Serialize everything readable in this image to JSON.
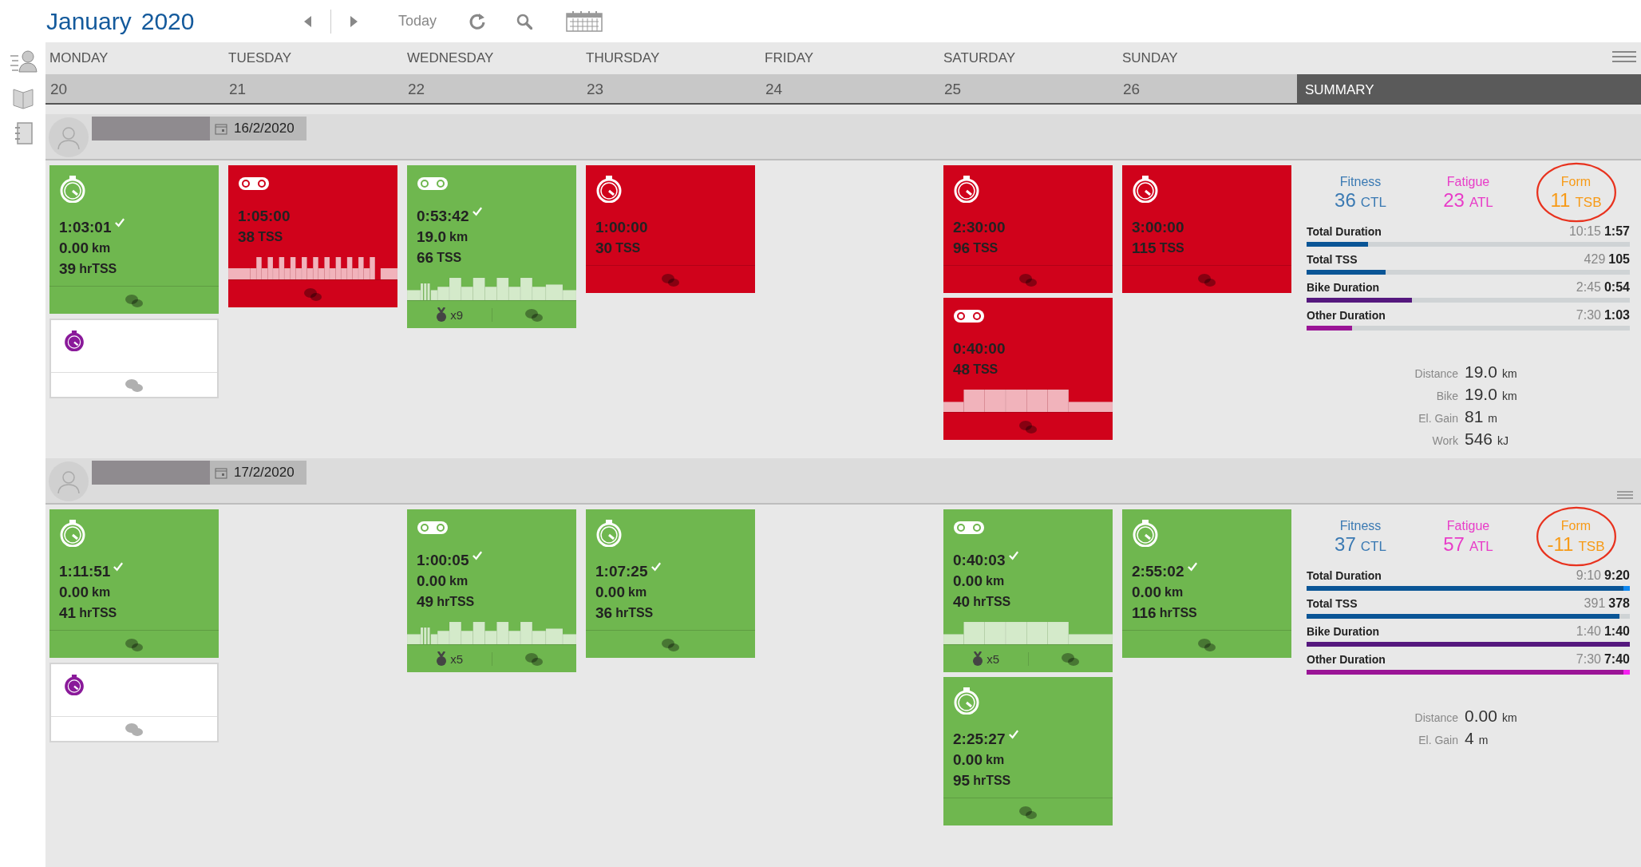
{
  "toolbar": {
    "month": "January",
    "year": "2020",
    "today": "Today"
  },
  "days": [
    {
      "name": "MONDAY",
      "date": "20"
    },
    {
      "name": "TUESDAY",
      "date": "21"
    },
    {
      "name": "WEDNESDAY",
      "date": "22"
    },
    {
      "name": "THURSDAY",
      "date": "23"
    },
    {
      "name": "FRIDAY",
      "date": "24"
    },
    {
      "name": "SATURDAY",
      "date": "25"
    },
    {
      "name": "SUNDAY",
      "date": "26"
    }
  ],
  "summary_label": "SUMMARY",
  "weeks": [
    {
      "date": "16/2/2020",
      "menu": false,
      "days": [
        {
          "kind": "training",
          "cards": [
            {
              "kind": "other",
              "planned": false,
              "color": "#6fb74f",
              "duration": "1:03:01",
              "check": true,
              "distance": {
                "value": "0.00",
                "unit": "km"
              },
              "load": {
                "value": "39",
                "unit": "hrTSS"
              }
            },
            {
              "kind": "other",
              "planned": true
            }
          ]
        },
        {
          "kind": "training",
          "cards": [
            {
              "kind": "bike",
              "planned": false,
              "color": "#d0021b",
              "duration": "1:05:00",
              "check": false,
              "load": {
                "value": "38",
                "unit": "TSS"
              },
              "profile": {
                "kind": "intervals"
              }
            }
          ]
        },
        {
          "kind": "training",
          "cards": [
            {
              "kind": "bike",
              "planned": false,
              "color": "#6fb74f",
              "duration": "0:53:42",
              "check": true,
              "distance": {
                "value": "19.0",
                "unit": "km"
              },
              "load": {
                "value": "66",
                "unit": "TSS"
              },
              "profile": {
                "kind": "mixed"
              },
              "medals": "x9"
            }
          ]
        },
        {
          "kind": "training",
          "cards": [
            {
              "kind": "other",
              "planned": false,
              "color": "#d0021b",
              "duration": "1:00:00",
              "check": false,
              "load": {
                "value": "30",
                "unit": "TSS"
              }
            }
          ]
        },
        {
          "kind": "rest"
        },
        {
          "kind": "training",
          "cards": [
            {
              "kind": "other",
              "planned": false,
              "color": "#d0021b",
              "duration": "2:30:00",
              "check": false,
              "load": {
                "value": "96",
                "unit": "TSS"
              }
            },
            {
              "kind": "bike",
              "planned": false,
              "color": "#d0021b",
              "duration": "0:40:00",
              "check": false,
              "load": {
                "value": "48",
                "unit": "TSS"
              },
              "profile": {
                "kind": "steady"
              }
            }
          ]
        },
        {
          "kind": "training",
          "cards": [
            {
              "kind": "other",
              "planned": false,
              "color": "#d0021b",
              "duration": "3:00:00",
              "check": false,
              "load": {
                "value": "115",
                "unit": "TSS"
              }
            }
          ]
        }
      ],
      "summary": {
        "fitness": {
          "label": "Fitness",
          "value": "36",
          "unit": "CTL"
        },
        "fatigue": {
          "label": "Fatigue",
          "value": "23",
          "unit": "ATL"
        },
        "form": {
          "label": "Form",
          "value": "11",
          "unit": "TSB",
          "circled": true
        },
        "bars": [
          {
            "label": "Total Duration",
            "planned": "10:15",
            "actual": "1:57",
            "level": 0.19,
            "over": false,
            "color": "#0a5596"
          },
          {
            "label": "Total TSS",
            "planned": "429",
            "actual": "105",
            "level": 0.245,
            "over": false,
            "color": "#0a5596"
          },
          {
            "label": "Bike Duration",
            "planned": "2:45",
            "actual": "0:54",
            "level": 0.325,
            "over": false,
            "color": "#55187e"
          },
          {
            "label": "Other Duration",
            "planned": "7:30",
            "actual": "1:03",
            "level": 0.14,
            "over": false,
            "color": "#9a1496"
          }
        ],
        "totals": [
          {
            "label": "Distance",
            "value": "19.0",
            "unit": "km"
          },
          {
            "label": "Bike",
            "value": "19.0",
            "unit": "km"
          },
          {
            "label": "El. Gain",
            "value": "81",
            "unit": "m"
          },
          {
            "label": "Work",
            "value": "546",
            "unit": "kJ"
          }
        ]
      }
    },
    {
      "date": "17/2/2020",
      "menu": true,
      "days": [
        {
          "kind": "training",
          "cards": [
            {
              "kind": "other",
              "planned": false,
              "color": "#6fb74f",
              "duration": "1:11:51",
              "check": true,
              "distance": {
                "value": "0.00",
                "unit": "km"
              },
              "load": {
                "value": "41",
                "unit": "hrTSS"
              }
            },
            {
              "kind": "other",
              "planned": true
            }
          ]
        },
        {
          "kind": "rest"
        },
        {
          "kind": "training",
          "cards": [
            {
              "kind": "bike",
              "planned": false,
              "color": "#6fb74f",
              "duration": "1:00:05",
              "check": true,
              "distance": {
                "value": "0.00",
                "unit": "km"
              },
              "load": {
                "value": "49",
                "unit": "hrTSS"
              },
              "profile": {
                "kind": "mixed"
              },
              "medals": "x5"
            }
          ]
        },
        {
          "kind": "training",
          "cards": [
            {
              "kind": "other",
              "planned": false,
              "color": "#6fb74f",
              "duration": "1:07:25",
              "check": true,
              "distance": {
                "value": "0.00",
                "unit": "km"
              },
              "load": {
                "value": "36",
                "unit": "hrTSS"
              }
            }
          ]
        },
        {
          "kind": "rest"
        },
        {
          "kind": "training",
          "cards": [
            {
              "kind": "bike",
              "planned": false,
              "color": "#6fb74f",
              "duration": "0:40:03",
              "check": true,
              "distance": {
                "value": "0.00",
                "unit": "km"
              },
              "load": {
                "value": "40",
                "unit": "hrTSS"
              },
              "profile": {
                "kind": "steady"
              },
              "medals": "x5"
            },
            {
              "kind": "other",
              "planned": false,
              "color": "#6fb74f",
              "duration": "2:25:27",
              "check": true,
              "distance": {
                "value": "0.00",
                "unit": "km"
              },
              "load": {
                "value": "95",
                "unit": "hrTSS"
              }
            }
          ]
        },
        {
          "kind": "training",
          "cards": [
            {
              "kind": "other",
              "planned": false,
              "color": "#6fb74f",
              "duration": "2:55:02",
              "check": true,
              "distance": {
                "value": "0.00",
                "unit": "km"
              },
              "load": {
                "value": "116",
                "unit": "hrTSS"
              }
            }
          ]
        }
      ],
      "summary": {
        "fitness": {
          "label": "Fitness",
          "value": "37",
          "unit": "CTL"
        },
        "fatigue": {
          "label": "Fatigue",
          "value": "57",
          "unit": "ATL"
        },
        "form": {
          "label": "Form",
          "value": "-11",
          "unit": "TSB",
          "circled": true
        },
        "bars": [
          {
            "label": "Total Duration",
            "planned": "9:10",
            "actual": "9:20",
            "level": 1,
            "over": true,
            "color": "#0a5596"
          },
          {
            "label": "Total TSS",
            "planned": "391",
            "actual": "378",
            "level": 0.967,
            "over": false,
            "color": "#0a5596"
          },
          {
            "label": "Bike Duration",
            "planned": "1:40",
            "actual": "1:40",
            "level": 1,
            "over": false,
            "color": "#55187e"
          },
          {
            "label": "Other Duration",
            "planned": "7:30",
            "actual": "7:40",
            "level": 1,
            "over": true,
            "color": "#9a1496"
          }
        ],
        "totals": [
          {
            "label": "Distance",
            "value": "0.00",
            "unit": "km"
          },
          {
            "label": "El. Gain",
            "value": "4",
            "unit": "m"
          }
        ]
      }
    }
  ]
}
